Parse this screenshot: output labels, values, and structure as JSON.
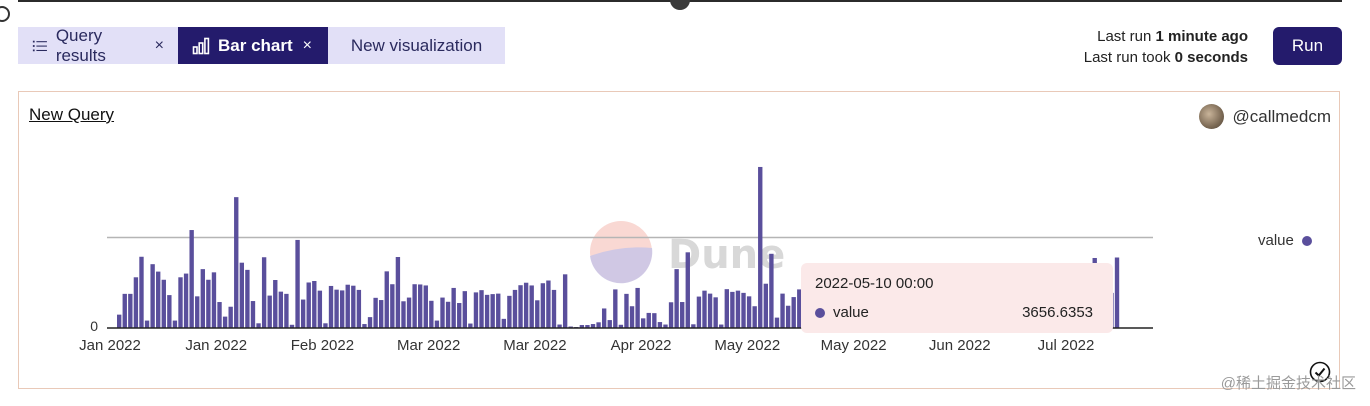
{
  "tabs": [
    {
      "label": "Query results",
      "icon": "list-icon",
      "closable": true
    },
    {
      "label": "Bar chart",
      "icon": "bar-chart-icon",
      "closable": true,
      "active": true
    },
    {
      "label": "New visualization",
      "closable": false
    }
  ],
  "close_glyph": "×",
  "run_info": {
    "line1_prefix": "Last run ",
    "line1_value": "1 minute ago",
    "line2_prefix": "Last run took ",
    "line2_value": "0 seconds"
  },
  "run_button": "Run",
  "panel": {
    "title": "New Query",
    "author": "@callmedcm"
  },
  "watermark": "Dune",
  "footer_watermark": "@稀土掘金技术社区",
  "legend_label": "value",
  "tooltip": {
    "date": "2022-05-10 00:00",
    "label": "value",
    "value": "3656.6353"
  },
  "colors": {
    "bar": "#5a4f9c",
    "accent": "#241b6c",
    "tab_bg": "#e2e0f7",
    "tooltip_bg": "#fbe9e9"
  },
  "chart_data": {
    "type": "bar",
    "series": [
      {
        "name": "value"
      }
    ],
    "x_tick_labels": [
      "Jan 2022",
      "Jan 2022",
      "Feb 2022",
      "Mar 2022",
      "Mar 2022",
      "Apr 2022",
      "May 2022",
      "May 2022",
      "Jun 2022",
      "Jul 2022"
    ],
    "y_tick_labels": [
      "0"
    ],
    "reference_line": 3656.6353,
    "ylim": [
      0,
      7600
    ],
    "values": [
      540,
      1380,
      1380,
      2050,
      2880,
      300,
      2580,
      2280,
      1950,
      1330,
      300,
      2050,
      2200,
      3960,
      1280,
      2380,
      1950,
      2250,
      1050,
      460,
      860,
      5290,
      2640,
      2350,
      1090,
      190,
      2860,
      1310,
      1940,
      1470,
      1380,
      130,
      3560,
      1150,
      1840,
      1900,
      1510,
      190,
      1700,
      1550,
      1520,
      1750,
      1710,
      1540,
      160,
      440,
      1220,
      1130,
      2290,
      1770,
      2870,
      1080,
      1230,
      1770,
      1760,
      1720,
      1100,
      300,
      1230,
      1060,
      1620,
      1010,
      1490,
      180,
      1440,
      1530,
      1340,
      1370,
      1390,
      370,
      1300,
      1540,
      1730,
      1830,
      1720,
      1120,
      1810,
      1920,
      1540,
      140,
      2170,
      60,
      40,
      120,
      120,
      160,
      230,
      790,
      320,
      1560,
      130,
      1380,
      880,
      1620,
      390,
      610,
      600,
      240,
      140,
      1040,
      2380,
      1050,
      3060,
      150,
      1270,
      1510,
      1390,
      1240,
      140,
      1570,
      1460,
      1510,
      1420,
      1280,
      880,
      6510,
      1790,
      3000,
      420,
      1390,
      900,
      1250,
      1560,
      1650,
      1250,
      980,
      1530,
      1210,
      1200,
      1210,
      1110,
      1100,
      250,
      1250,
      1200,
      1350,
      1200,
      1170,
      1250,
      1340,
      1200,
      1260,
      1240,
      1300,
      1250,
      1150,
      1180,
      1120,
      1200,
      1280,
      1210,
      1350,
      1250,
      1170,
      1130,
      1190,
      1280,
      1200,
      1250,
      1160,
      1180,
      1200,
      1220,
      1180,
      1150,
      1130,
      1240,
      1180,
      1350,
      1210,
      1180,
      1200,
      560,
      520,
      1310,
      2830,
      1770,
      440,
      1420,
      2850
    ]
  }
}
